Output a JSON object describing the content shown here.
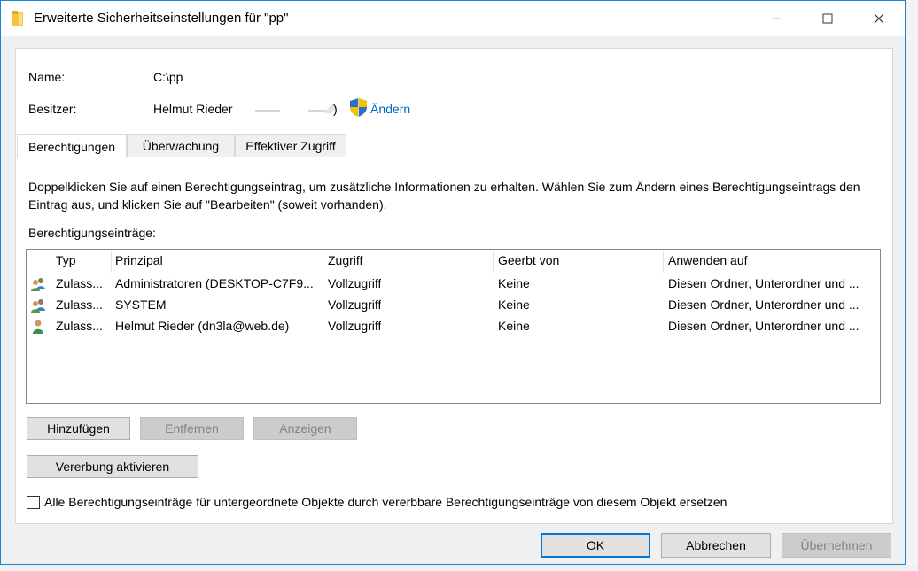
{
  "window": {
    "title": "Erweiterte Sicherheitseinstellungen für \"pp\""
  },
  "info": {
    "name_label": "Name:",
    "name_value": "C:\\pp",
    "owner_label": "Besitzer:",
    "owner_value": "Helmut Rieder",
    "owner_paren": ")",
    "change_link": "Ändern"
  },
  "tabs": [
    {
      "label": "Berechtigungen",
      "active": true
    },
    {
      "label": "Überwachung",
      "active": false
    },
    {
      "label": "Effektiver Zugriff",
      "active": false
    }
  ],
  "description": "Doppelklicken Sie auf einen Berechtigungseintrag, um zusätzliche Informationen zu erhalten. Wählen Sie zum Ändern eines Berechtigungseintrags den Eintrag aus, und klicken Sie auf \"Bearbeiten\" (soweit vorhanden).",
  "entries_label": "Berechtigungseinträge:",
  "table": {
    "columns": [
      "Typ",
      "Prinzipal",
      "Zugriff",
      "Geerbt von",
      "Anwenden auf"
    ],
    "rows": [
      {
        "icon": "user-group-icon",
        "type": "Zulass...",
        "principal": "Administratoren (DESKTOP-C7F9...",
        "access": "Vollzugriff",
        "inherited": "Keine",
        "applies": "Diesen Ordner, Unterordner und ..."
      },
      {
        "icon": "user-group-icon",
        "type": "Zulass...",
        "principal": "SYSTEM",
        "access": "Vollzugriff",
        "inherited": "Keine",
        "applies": "Diesen Ordner, Unterordner und ..."
      },
      {
        "icon": "user-icon",
        "type": "Zulass...",
        "principal": "Helmut Rieder (dn3la@web.de)",
        "access": "Vollzugriff",
        "inherited": "Keine",
        "applies": "Diesen Ordner, Unterordner und ..."
      }
    ]
  },
  "buttons": {
    "add": "Hinzufügen",
    "remove": "Entfernen",
    "view": "Anzeigen",
    "inherit": "Vererbung aktivieren",
    "ok": "OK",
    "cancel": "Abbrechen",
    "apply": "Übernehmen"
  },
  "checkbox": {
    "label": "Alle Berechtigungseinträge für untergeordnete Objekte durch vererbbare Berechtigungseinträge von diesem Objekt ersetzen",
    "checked": false
  },
  "colors": {
    "accent": "#0078d7",
    "link": "#0066cc",
    "window_border": "#1883d7"
  }
}
